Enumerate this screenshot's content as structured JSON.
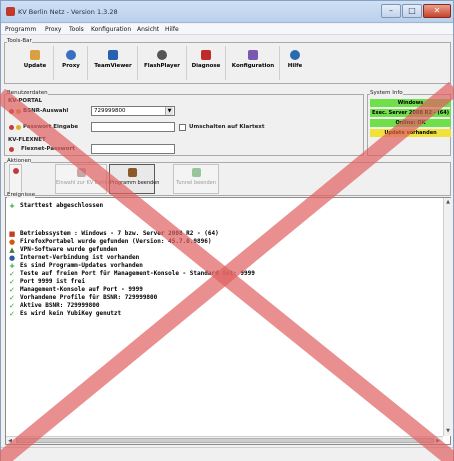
{
  "window": {
    "title": "KV Berlin Netz - Version 1.3.28"
  },
  "menu": [
    "Programm",
    "Proxy",
    "Tools",
    "Konfiguration",
    "Ansicht",
    "Hilfe"
  ],
  "toolbar": {
    "group_label": "Tools-Bar",
    "items": [
      {
        "label": "Update",
        "icon": "update-icon"
      },
      {
        "label": "Proxy",
        "icon": "globe-icon"
      },
      {
        "label": "TeamViewer",
        "icon": "monitor-icon"
      },
      {
        "label": "FlashPlayer",
        "icon": "flash-icon"
      },
      {
        "label": "Diagnose",
        "icon": "diagnose-icon"
      },
      {
        "label": "Konfiguration",
        "icon": "gear-icon"
      },
      {
        "label": "Hilfe",
        "icon": "help-icon"
      }
    ]
  },
  "benutzerdaten": {
    "group_label": "Benutzerdaten",
    "kv_portal": {
      "label": "KV-PORTAL",
      "bsnr_label": "BSNR-Auswahl",
      "bsnr_value": "729999800",
      "passwort_label": "Passwort Eingabe",
      "umschalten_label": "Umschalten auf Klartext"
    },
    "kv_flexnet": {
      "label": "KV-FLEXNET",
      "passwort_label": "Flexnet-Passwort"
    }
  },
  "aktionen": {
    "group_label": "Aktionen",
    "buttons": [
      {
        "label": "Einwahl zur KV Berlin",
        "icon": "dial-icon",
        "active": false
      },
      {
        "label": "Programm beenden",
        "icon": "exit-door-icon",
        "active": true
      },
      {
        "label": "Tunnel beenden",
        "icon": "tunnel-icon",
        "active": false
      }
    ]
  },
  "system_info": {
    "group_label": "System Info",
    "items": [
      {
        "text": "Windows",
        "color": "#6fe04a"
      },
      {
        "text": "Exec. Server 2008 R2 - (64)",
        "color": "#6fe04a"
      },
      {
        "text": "Online: OK",
        "color": "#6fe04a"
      },
      {
        "text": "Update vorhanden",
        "color": "#f0e23a"
      }
    ]
  },
  "ereignisse": {
    "group_label": "Ereignisse",
    "lines": [
      {
        "icon": "plus",
        "color": "#1a9a1a",
        "text": "Starttest abgeschlossen"
      },
      {
        "icon": "none",
        "color": "#000000",
        "text": ""
      },
      {
        "icon": "computer",
        "color": "#c04020",
        "text": "Betriebssystem : Windows - 7 bzw. Server 2008 R2 - (64)"
      },
      {
        "icon": "firefox",
        "color": "#d05a10",
        "text": "FirefoxPortabel wurde gefunden (Version: 45.7.0.9896)"
      },
      {
        "icon": "vpn",
        "color": "#4a7a30",
        "text": "VPN-Software wurde gefunden"
      },
      {
        "icon": "globe",
        "color": "#2a5aa0",
        "text": "Internet-Verbindung ist vorhanden"
      },
      {
        "icon": "plus",
        "color": "#1a9a1a",
        "text": "Es sind Programm-Updates vorhanden"
      },
      {
        "icon": "check",
        "color": "#1a9a1a",
        "text": "Teste auf freien Port für Management-Konsole - Standard ist: 9999"
      },
      {
        "icon": "check",
        "color": "#1a9a1a",
        "text": "Port 9999 ist frei"
      },
      {
        "icon": "check",
        "color": "#1a9a1a",
        "text": "Management-Konsole auf Port - 9999"
      },
      {
        "icon": "check",
        "color": "#1a9a1a",
        "text": "Vorhandene Profile für BSNR: 729999800"
      },
      {
        "icon": "check",
        "color": "#1a9a1a",
        "text": "Aktive BSNR: 729999800"
      },
      {
        "icon": "check",
        "color": "#1a9a1a",
        "text": "Es wird kein YubiKey genutzt"
      }
    ]
  },
  "overlay": {
    "color": "#e06060"
  }
}
